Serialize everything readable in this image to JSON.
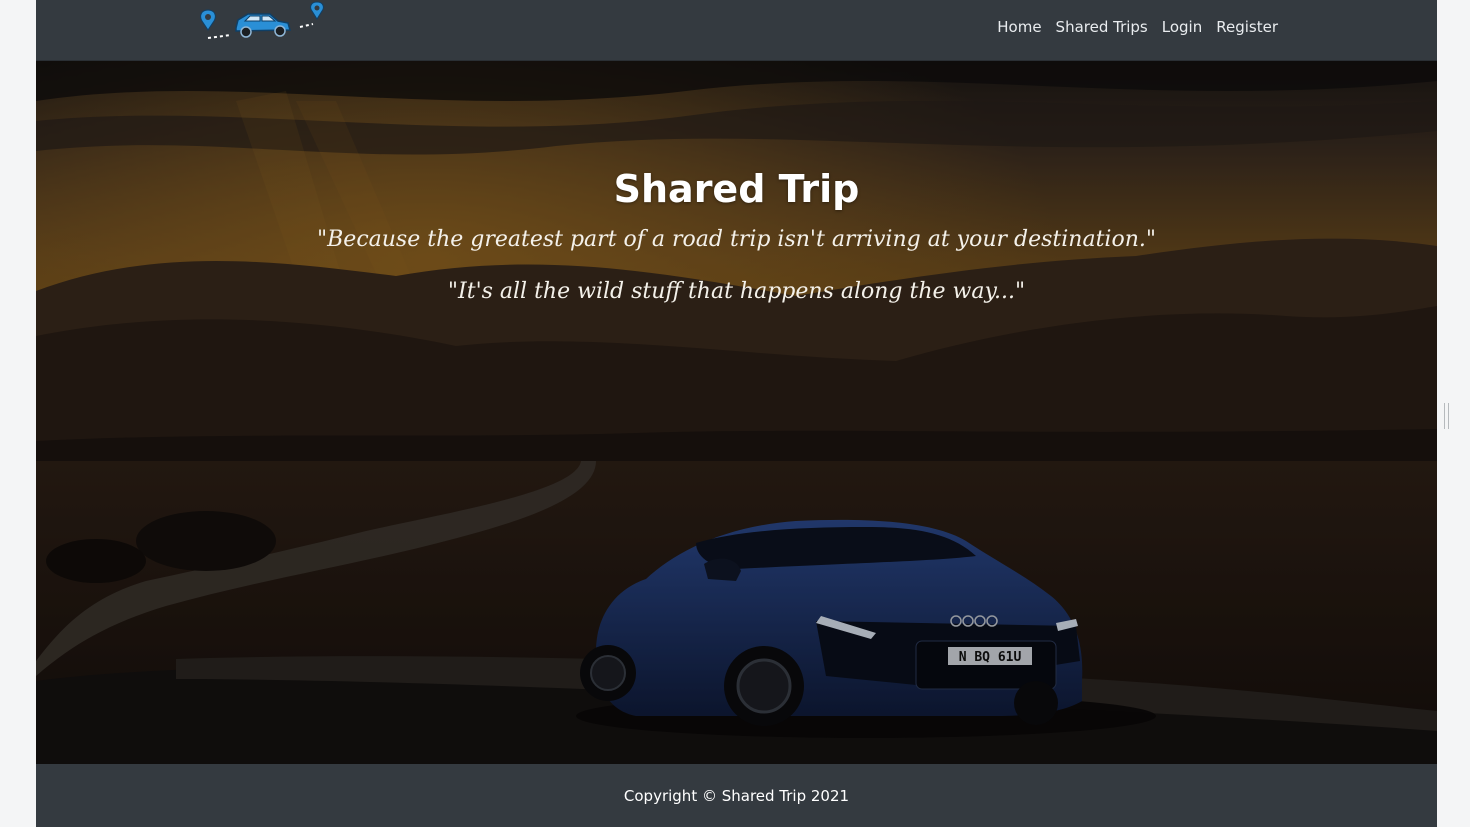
{
  "nav": {
    "brand_alt": "Shared Trip logo",
    "links": [
      {
        "label": "Home"
      },
      {
        "label": "Shared Trips"
      },
      {
        "label": "Login"
      },
      {
        "label": "Register"
      }
    ]
  },
  "hero": {
    "title": "Shared Trip",
    "quote_1": "\"Because the greatest part of a road trip isn't arriving at your destination.\"",
    "quote_2": "\"It's all the wild stuff that happens along the way...\"",
    "car_plate": "N BQ 61U"
  },
  "footer": {
    "text": "Copyright © Shared Trip 2021"
  },
  "colors": {
    "navbar_bg": "#343a40",
    "nav_text": "#e9ecef",
    "brand_pin": "#2a8fd6",
    "car_blue": "#1f3a78"
  },
  "icons": {
    "brand": "car-route-icon",
    "pins": "map-pin-icon"
  }
}
